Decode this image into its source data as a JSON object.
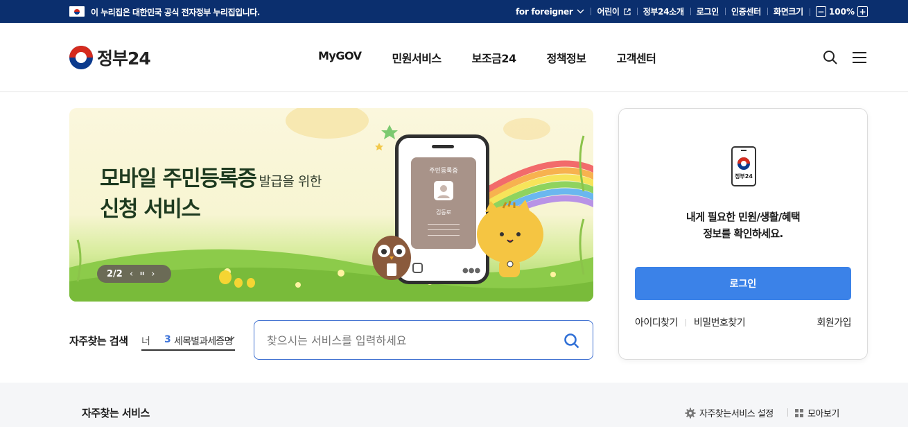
{
  "topbar": {
    "notice": "이 누리집은 대한민국 공식 전자정부 누리집입니다.",
    "foreigner": "for foreigner",
    "kids": "어린이",
    "about": "정부24소개",
    "login": "로그인",
    "cert": "인증센터",
    "zoom_label": "화면크기",
    "zoom_minus": "−",
    "zoom_value": "100%",
    "zoom_plus": "+"
  },
  "header": {
    "logo_text": "정부24",
    "menu": [
      "MyGOV",
      "민원서비스",
      "보조금24",
      "정책정보",
      "고객센터"
    ]
  },
  "banner": {
    "title_line1": "모바일 주민등록증",
    "title_line1_small": "발급을 위한",
    "title_line2": "신청 서비스",
    "pager": "2/2",
    "prev": "‹",
    "pause": "ıı",
    "next": "›",
    "card_title": "주민등록증",
    "card_name": "김동로"
  },
  "frequent_search": {
    "label": "자주찾는 검색",
    "prev_word": "너",
    "rank_num": "3",
    "rank_word": "세목별과세증명",
    "search_placeholder": "찾으시는 서비스를 입력하세요"
  },
  "login_panel": {
    "device_text": "정부24",
    "message_line1": "내게 필요한 민원/생활/혜택",
    "message_line2": "정보를 확인하세요.",
    "login_button": "로그인",
    "find_id": "아이디찾기",
    "find_pw": "비밀번호찾기",
    "join": "회원가입"
  },
  "frequent_services": {
    "title": "자주찾는 서비스",
    "settings": "자주찾는서비스 설정",
    "view_all": "모아보기"
  },
  "colors": {
    "topbar_bg": "#0b2f6e",
    "accent": "#3b82e8",
    "search_border": "#3d6fd0"
  }
}
